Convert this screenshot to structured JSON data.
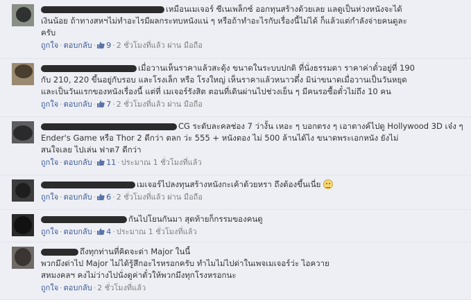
{
  "comments": [
    {
      "lines": [
        "เหมือนเมเจอร์ ซีเนเพล็กซ์ ออกทุนสร้างด้วยเลย แลดูเป็นห่วงหนังจะได้",
        "เงินน้อย ถ้าทางสหฯไม่ทำอะไรมีผลกระทบหนังแน่ ๆ หรือถ้าทำอะไรกับเรื่องนี้ไม่ได้ ก็แล้วแต่กำลังจ่ายคนดูละ",
        "ครับ"
      ],
      "like_label": "ถูกใจ",
      "reply_label": "ตอบกลับ",
      "likes": "9",
      "time": "2 ชั่วโมงที่แล้ว ผ่าน มือถือ"
    },
    {
      "lines": [
        "เมื่อวานเห็นราคาแล้วสะดุ้ง ขนาดในระบบปกติ ที่นั่งธรรมดา ราคาค่าตั๋วอยู่ที่ 190",
        "กับ 210, 220 ขึ้นอยู่กับรอบ และโรงเล็ก หรือ โรงใหญ่ เห็นราคาแล้วหนาวดึ๋ง มิน่าขนาดเมื่อวานเป็นวันหยุด",
        "และเป็นวันแรกของหนังเรื่องนี้ แต่ที่ เมเจอร์รังสิต ตอนที่เดินผ่านไปช่วงเย็น ๆ มีคนรอซื้อตั๋วไม่ถึง 10 คน"
      ],
      "like_label": "ถูกใจ",
      "reply_label": "ตอบกลับ",
      "likes": "7",
      "time": "2 ชั่วโมงที่แล้ว ผ่าน มือถือ"
    },
    {
      "lines": [
        "CG ระดับละคลช่อง 7 ว่างั้น เหอะ ๆ บอกตรง ๆ เอาตางค์ไปดู Hollywood 3D เจ๋ง ๆ",
        "Ender's Game หรือ Thor 2 ดีกว่า ตลก ว่ะ 555 + หนังตอง ไม่ 500 ล้านได้ไง ขนาดพระเอกหนัง ยังไม่",
        "สนใจเลย ไปเล่น ฟาต7 ดีกว่า"
      ],
      "like_label": "ถูกใจ",
      "reply_label": "ตอบกลับ",
      "likes": "11",
      "time": "ประมาณ 1 ชั่วโมงที่แล้ว"
    },
    {
      "lines": [
        "เมเจอร์ไปลงทุนสร้างหนังกะเค้าด้วยหรา ถึงต้องขึ้นเนี่ย"
      ],
      "like_label": "ถูกใจ",
      "reply_label": "ตอบกลับ",
      "likes": "6",
      "time": "2 ชั่วโมงที่แล้ว ผ่าน มือถือ"
    },
    {
      "lines": [
        "กันไปโยนกันมา สุดท้ายก็กรรมของคนดู"
      ],
      "like_label": "ถูกใจ",
      "reply_label": "ตอบกลับ",
      "likes": "4",
      "time": "ประมาณ 1 ชั่วโมงที่แล้ว"
    },
    {
      "lines": [
        "ถึงทุกท่านที่คิดจะด่า Major ในนี้",
        "พวกมึงด่าไป Major ไม่ได้รู้สึกอะไรหรอกครับ ทำไมไม่ไปด่าในเพจเมเจอร์ว่ะ ไอควาย",
        "สหมงคลฯ คงไม่ว่างไปนั่งดูค่าตั๋วให้พวกมึงทุกโรงหรอกนะ"
      ],
      "like_label": "ถูกใจ",
      "reply_label": "ตอบกลับ",
      "likes": "",
      "time": "2 ชั่วโมงที่แล้ว"
    }
  ],
  "colors": {
    "link": "#3b5998",
    "meta": "#7f7f7f",
    "row_bg": "#edeff4",
    "text": "#333333"
  },
  "icons": {
    "like": "thumbs-up-icon",
    "emoji": "smiley-emoji-icon"
  }
}
